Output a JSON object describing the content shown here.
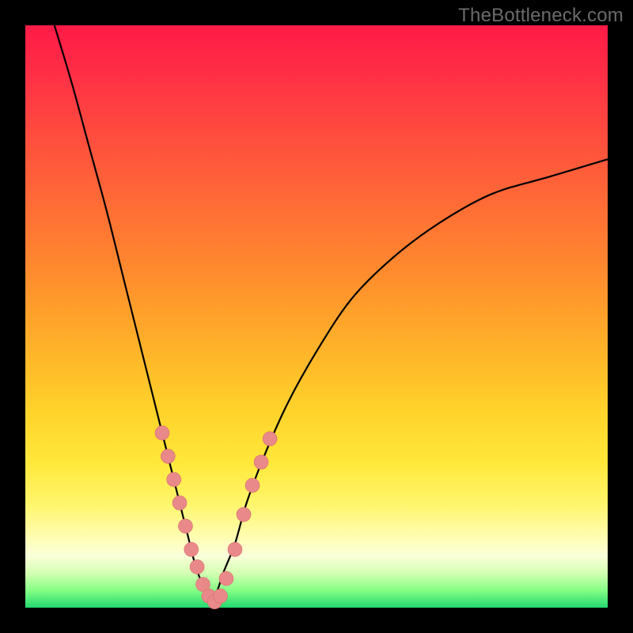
{
  "watermark": "TheBottleneck.com",
  "chart_data": {
    "type": "line",
    "title": "",
    "xlabel": "",
    "ylabel": "",
    "xlim": [
      0,
      100
    ],
    "ylim": [
      0,
      100
    ],
    "legend": null,
    "grid": false,
    "series": [
      {
        "name": "bottleneck-curve-left",
        "x": [
          5,
          8,
          11,
          14,
          17,
          20,
          22,
          24,
          26,
          28,
          29,
          30,
          31,
          32
        ],
        "y": [
          100,
          90,
          79,
          68,
          56,
          44,
          36,
          28,
          20,
          12,
          8,
          5,
          3,
          1
        ]
      },
      {
        "name": "bottleneck-curve-right",
        "x": [
          32,
          33,
          34,
          36,
          38,
          41,
          45,
          50,
          56,
          63,
          71,
          80,
          90,
          100
        ],
        "y": [
          1,
          3,
          6,
          11,
          18,
          26,
          35,
          44,
          53,
          60,
          66,
          71,
          74,
          77
        ]
      }
    ],
    "scatter_points": {
      "name": "highlighted-region-dots",
      "points": [
        {
          "x": 23.5,
          "y": 30
        },
        {
          "x": 24.5,
          "y": 26
        },
        {
          "x": 25.5,
          "y": 22
        },
        {
          "x": 26.5,
          "y": 18
        },
        {
          "x": 27.5,
          "y": 14
        },
        {
          "x": 28.5,
          "y": 10
        },
        {
          "x": 29.5,
          "y": 7
        },
        {
          "x": 30.5,
          "y": 4
        },
        {
          "x": 31.5,
          "y": 2
        },
        {
          "x": 32.5,
          "y": 1
        },
        {
          "x": 33.5,
          "y": 2
        },
        {
          "x": 34.5,
          "y": 5
        },
        {
          "x": 36.0,
          "y": 10
        },
        {
          "x": 37.5,
          "y": 16
        },
        {
          "x": 39.0,
          "y": 21
        },
        {
          "x": 40.5,
          "y": 25
        },
        {
          "x": 42.0,
          "y": 29
        }
      ]
    },
    "gradient_stops": [
      {
        "pos": 0,
        "color": "#ff1a47"
      },
      {
        "pos": 50,
        "color": "#ffb129"
      },
      {
        "pos": 85,
        "color": "#fff56a"
      },
      {
        "pos": 100,
        "color": "#23d870"
      }
    ]
  }
}
